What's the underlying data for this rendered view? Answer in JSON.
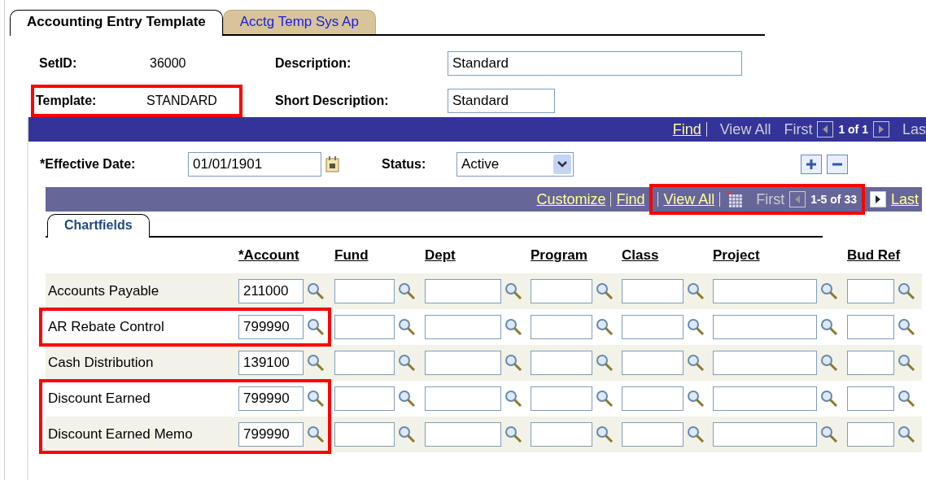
{
  "tabs": [
    {
      "label": "Accounting Entry Template",
      "selected": true
    },
    {
      "label": "Acctg Temp Sys Ap",
      "selected": false
    }
  ],
  "header": {
    "setid_label": "SetID:",
    "setid": "36000",
    "template_label": "Template:",
    "template": "STANDARD",
    "template_highlighted": true,
    "description_label": "Description:",
    "description": "Standard",
    "short_description_label": "Short Description:",
    "short_description": "Standard"
  },
  "effdt_nav": [
    {
      "kind": "link",
      "text": "Find"
    },
    {
      "kind": "sep"
    },
    {
      "kind": "disabled",
      "text": "View All"
    },
    {
      "kind": "disabled",
      "text": "First"
    },
    {
      "kind": "prev",
      "disabled": true
    },
    {
      "kind": "count",
      "text": "1 of 1"
    },
    {
      "kind": "next",
      "disabled": true
    },
    {
      "kind": "disabled",
      "text": "Las"
    }
  ],
  "effective_date": {
    "label": "*Effective Date:",
    "value": "01/01/1901",
    "status_label": "Status:",
    "status": "Active"
  },
  "grid_nav": {
    "before": [
      {
        "kind": "link",
        "text": "Customize"
      },
      {
        "kind": "sep"
      },
      {
        "kind": "link",
        "text": "Find"
      }
    ],
    "highlighted": [
      {
        "kind": "sep"
      },
      {
        "kind": "link",
        "text": "View All"
      },
      {
        "kind": "sep"
      },
      {
        "kind": "grid"
      },
      {
        "kind": "disabled",
        "text": "First"
      },
      {
        "kind": "prev",
        "disabled": true
      },
      {
        "kind": "count",
        "text": "1-5 of 33"
      }
    ],
    "after": [
      {
        "kind": "next",
        "disabled": false
      },
      {
        "kind": "link",
        "text": "Last"
      }
    ]
  },
  "grid_tab": {
    "label": "Chartfields"
  },
  "columns": [
    "*Account",
    "Fund",
    "Dept",
    "Program",
    "Class",
    "Project",
    "Bud Ref"
  ],
  "rows": [
    {
      "label": "Accounts Payable",
      "account": "211000",
      "highlighted": false
    },
    {
      "label": "AR Rebate Control",
      "account": "799990",
      "highlighted": true
    },
    {
      "label": "Cash Distribution",
      "account": "139100",
      "highlighted": false
    },
    {
      "label": "Discount Earned",
      "account": "799990",
      "highlighted": true
    },
    {
      "label": "Discount Earned Memo",
      "account": "799990",
      "highlighted": true
    }
  ]
}
